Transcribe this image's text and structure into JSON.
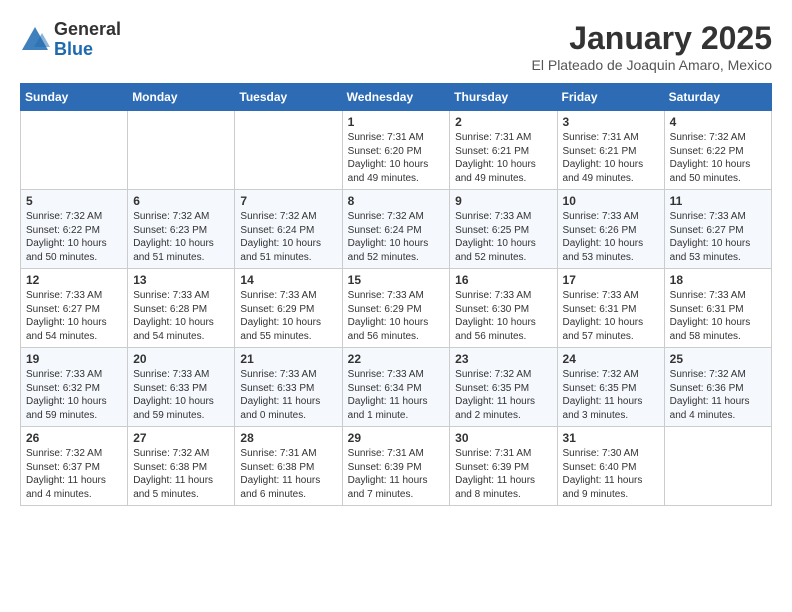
{
  "header": {
    "logo_general": "General",
    "logo_blue": "Blue",
    "month": "January 2025",
    "location": "El Plateado de Joaquin Amaro, Mexico"
  },
  "weekdays": [
    "Sunday",
    "Monday",
    "Tuesday",
    "Wednesday",
    "Thursday",
    "Friday",
    "Saturday"
  ],
  "weeks": [
    [
      {
        "day": "",
        "info": ""
      },
      {
        "day": "",
        "info": ""
      },
      {
        "day": "",
        "info": ""
      },
      {
        "day": "1",
        "info": "Sunrise: 7:31 AM\nSunset: 6:20 PM\nDaylight: 10 hours\nand 49 minutes."
      },
      {
        "day": "2",
        "info": "Sunrise: 7:31 AM\nSunset: 6:21 PM\nDaylight: 10 hours\nand 49 minutes."
      },
      {
        "day": "3",
        "info": "Sunrise: 7:31 AM\nSunset: 6:21 PM\nDaylight: 10 hours\nand 49 minutes."
      },
      {
        "day": "4",
        "info": "Sunrise: 7:32 AM\nSunset: 6:22 PM\nDaylight: 10 hours\nand 50 minutes."
      }
    ],
    [
      {
        "day": "5",
        "info": "Sunrise: 7:32 AM\nSunset: 6:22 PM\nDaylight: 10 hours\nand 50 minutes."
      },
      {
        "day": "6",
        "info": "Sunrise: 7:32 AM\nSunset: 6:23 PM\nDaylight: 10 hours\nand 51 minutes."
      },
      {
        "day": "7",
        "info": "Sunrise: 7:32 AM\nSunset: 6:24 PM\nDaylight: 10 hours\nand 51 minutes."
      },
      {
        "day": "8",
        "info": "Sunrise: 7:32 AM\nSunset: 6:24 PM\nDaylight: 10 hours\nand 52 minutes."
      },
      {
        "day": "9",
        "info": "Sunrise: 7:33 AM\nSunset: 6:25 PM\nDaylight: 10 hours\nand 52 minutes."
      },
      {
        "day": "10",
        "info": "Sunrise: 7:33 AM\nSunset: 6:26 PM\nDaylight: 10 hours\nand 53 minutes."
      },
      {
        "day": "11",
        "info": "Sunrise: 7:33 AM\nSunset: 6:27 PM\nDaylight: 10 hours\nand 53 minutes."
      }
    ],
    [
      {
        "day": "12",
        "info": "Sunrise: 7:33 AM\nSunset: 6:27 PM\nDaylight: 10 hours\nand 54 minutes."
      },
      {
        "day": "13",
        "info": "Sunrise: 7:33 AM\nSunset: 6:28 PM\nDaylight: 10 hours\nand 54 minutes."
      },
      {
        "day": "14",
        "info": "Sunrise: 7:33 AM\nSunset: 6:29 PM\nDaylight: 10 hours\nand 55 minutes."
      },
      {
        "day": "15",
        "info": "Sunrise: 7:33 AM\nSunset: 6:29 PM\nDaylight: 10 hours\nand 56 minutes."
      },
      {
        "day": "16",
        "info": "Sunrise: 7:33 AM\nSunset: 6:30 PM\nDaylight: 10 hours\nand 56 minutes."
      },
      {
        "day": "17",
        "info": "Sunrise: 7:33 AM\nSunset: 6:31 PM\nDaylight: 10 hours\nand 57 minutes."
      },
      {
        "day": "18",
        "info": "Sunrise: 7:33 AM\nSunset: 6:31 PM\nDaylight: 10 hours\nand 58 minutes."
      }
    ],
    [
      {
        "day": "19",
        "info": "Sunrise: 7:33 AM\nSunset: 6:32 PM\nDaylight: 10 hours\nand 59 minutes."
      },
      {
        "day": "20",
        "info": "Sunrise: 7:33 AM\nSunset: 6:33 PM\nDaylight: 10 hours\nand 59 minutes."
      },
      {
        "day": "21",
        "info": "Sunrise: 7:33 AM\nSunset: 6:33 PM\nDaylight: 11 hours\nand 0 minutes."
      },
      {
        "day": "22",
        "info": "Sunrise: 7:33 AM\nSunset: 6:34 PM\nDaylight: 11 hours\nand 1 minute."
      },
      {
        "day": "23",
        "info": "Sunrise: 7:32 AM\nSunset: 6:35 PM\nDaylight: 11 hours\nand 2 minutes."
      },
      {
        "day": "24",
        "info": "Sunrise: 7:32 AM\nSunset: 6:35 PM\nDaylight: 11 hours\nand 3 minutes."
      },
      {
        "day": "25",
        "info": "Sunrise: 7:32 AM\nSunset: 6:36 PM\nDaylight: 11 hours\nand 4 minutes."
      }
    ],
    [
      {
        "day": "26",
        "info": "Sunrise: 7:32 AM\nSunset: 6:37 PM\nDaylight: 11 hours\nand 4 minutes."
      },
      {
        "day": "27",
        "info": "Sunrise: 7:32 AM\nSunset: 6:38 PM\nDaylight: 11 hours\nand 5 minutes."
      },
      {
        "day": "28",
        "info": "Sunrise: 7:31 AM\nSunset: 6:38 PM\nDaylight: 11 hours\nand 6 minutes."
      },
      {
        "day": "29",
        "info": "Sunrise: 7:31 AM\nSunset: 6:39 PM\nDaylight: 11 hours\nand 7 minutes."
      },
      {
        "day": "30",
        "info": "Sunrise: 7:31 AM\nSunset: 6:39 PM\nDaylight: 11 hours\nand 8 minutes."
      },
      {
        "day": "31",
        "info": "Sunrise: 7:30 AM\nSunset: 6:40 PM\nDaylight: 11 hours\nand 9 minutes."
      },
      {
        "day": "",
        "info": ""
      }
    ]
  ]
}
